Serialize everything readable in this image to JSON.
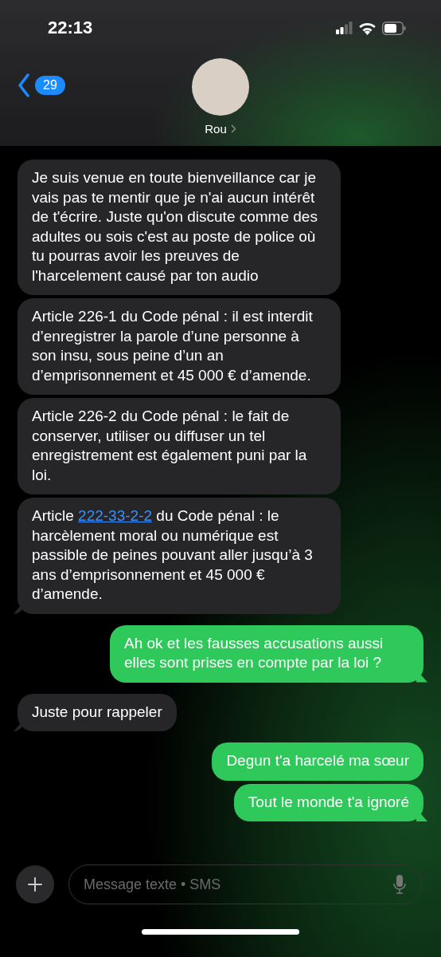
{
  "status_bar": {
    "time": "22:13"
  },
  "header": {
    "back_count": "29",
    "contact_name": "Rou"
  },
  "messages": [
    {
      "kind": "received",
      "tail": false,
      "parts": [
        {
          "text": "Je suis venue en toute bienveillance car je vais pas te mentir que je n'ai aucun intérêt de t'écrire.  Juste qu'on discute comme des adultes ou sois c'est au poste de police où tu pourras avoir les preuves de l'harcelement causé par ton audio"
        }
      ]
    },
    {
      "kind": "received",
      "tail": false,
      "parts": [
        {
          "text": "Article 226-1 du Code pénal : il est interdit d’enregistrer la parole d’une personne à son insu, sous peine d’un an d’emprisonnement et 45 000 € d’amende."
        }
      ]
    },
    {
      "kind": "received",
      "tail": false,
      "parts": [
        {
          "text": "Article 226-2 du Code pénal : le fait de conserver, utiliser ou diffuser un tel enregistrement est également puni par la loi."
        }
      ]
    },
    {
      "kind": "received",
      "tail": true,
      "parts": [
        {
          "text": "Article "
        },
        {
          "text": "222-33-2-2",
          "kind": "link"
        },
        {
          "text": " du Code pénal : le harcèlement moral ou numérique est passible de peines pouvant aller jusqu’à 3 ans d’emprisonnement et 45 000 € d’amende."
        }
      ]
    },
    {
      "kind": "sent",
      "tail": true,
      "parts": [
        {
          "text": "Ah ok et les fausses accusations aussi elles sont prises en compte par la loi ?"
        }
      ]
    },
    {
      "kind": "received",
      "tail": true,
      "parts": [
        {
          "text": "Juste pour rappeler"
        }
      ]
    },
    {
      "kind": "sent",
      "tail": false,
      "parts": [
        {
          "text": "Degun t'a harcelé ma sœur"
        }
      ]
    },
    {
      "kind": "sent",
      "tail": true,
      "parts": [
        {
          "text": "Tout le monde t'a ignoré"
        }
      ]
    }
  ],
  "composer": {
    "placeholder": "Message texte • SMS"
  }
}
